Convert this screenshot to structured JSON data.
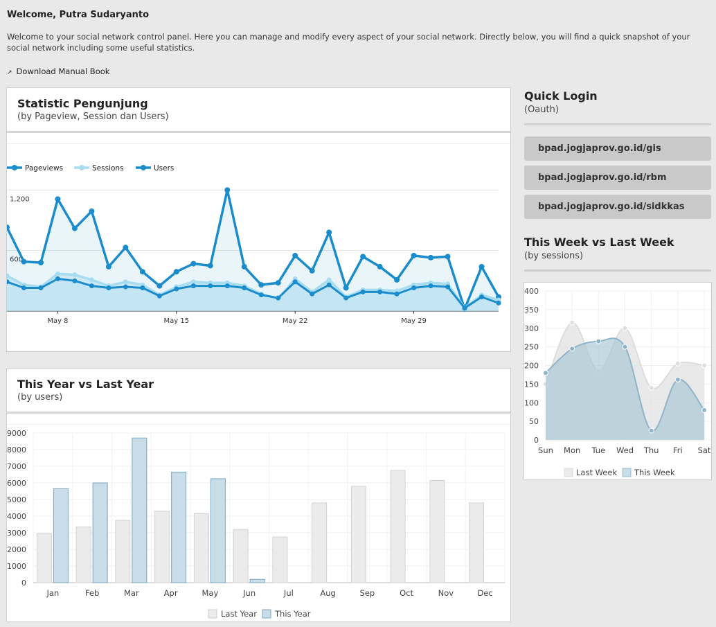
{
  "header": {
    "welcome": "Welcome, Putra Sudaryanto",
    "intro": "Welcome to your social network control panel. Here you can manage and modify every aspect of your social network. Directly below, you will find a quick snapshot of your social network including some useful statistics.",
    "download_label": "Download Manual Book"
  },
  "stat_panel": {
    "title": "Statistic Pengunjung",
    "subtitle": "(by Pageview, Session dan Users)"
  },
  "year_panel": {
    "title": "This Year vs Last Year",
    "subtitle": "(by users)"
  },
  "quick_login": {
    "title": "Quick Login",
    "subtitle": "(Oauth)",
    "links": [
      "bpad.jogjaprov.go.id/gis",
      "bpad.jogjaprov.go.id/rbm",
      "bpad.jogjaprov.go.id/sidkkas"
    ]
  },
  "week_panel": {
    "title": "This Week vs Last Week",
    "subtitle": "(by sessions)"
  },
  "colors": {
    "users": "#1a8ccc",
    "sessions": "#a8dcf0",
    "this_year_fill": "#c9dde9",
    "this_year_stroke": "#7aa6c0",
    "last_year_fill": "#ebebeb"
  },
  "chart_data": [
    {
      "type": "line",
      "x_labels": [
        "May 8",
        "May 15",
        "May 22",
        "May 29"
      ],
      "y_ticks": [
        "1,200",
        "600"
      ],
      "legend": [
        "Pageviews",
        "Sessions",
        "Users"
      ],
      "pageviews": [
        830,
        490,
        480,
        1110,
        820,
        990,
        440,
        630,
        390,
        250,
        390,
        470,
        450,
        1200,
        440,
        260,
        280,
        550,
        400,
        780,
        230,
        540,
        440,
        310,
        550,
        530,
        540,
        20,
        440,
        140
      ],
      "sessions": [
        350,
        260,
        240,
        370,
        360,
        310,
        250,
        290,
        260,
        160,
        240,
        290,
        280,
        280,
        250,
        170,
        120,
        320,
        190,
        310,
        140,
        210,
        210,
        200,
        260,
        280,
        270,
        30,
        160,
        110
      ],
      "users": [
        290,
        230,
        230,
        320,
        300,
        250,
        230,
        240,
        230,
        150,
        220,
        250,
        250,
        250,
        230,
        160,
        130,
        290,
        170,
        260,
        130,
        190,
        190,
        170,
        230,
        250,
        240,
        30,
        140,
        80
      ]
    },
    {
      "type": "bar",
      "categories": [
        "Jan",
        "Feb",
        "Mar",
        "Apr",
        "May",
        "Jun",
        "Jul",
        "Aug",
        "Sep",
        "Oct",
        "Nov",
        "Dec"
      ],
      "ylim": [
        0,
        9000
      ],
      "y_ticks": [
        0,
        1000,
        2000,
        3000,
        4000,
        5000,
        6000,
        7000,
        8000,
        9000
      ],
      "series": [
        {
          "name": "Last Year",
          "values": [
            2950,
            3350,
            3750,
            4300,
            4150,
            3200,
            2750,
            4800,
            5800,
            6750,
            6150,
            4800
          ]
        },
        {
          "name": "This Year",
          "values": [
            5650,
            6000,
            8700,
            6650,
            6250,
            200,
            null,
            null,
            null,
            null,
            null,
            null
          ]
        }
      ]
    },
    {
      "type": "area",
      "categories": [
        "Sun",
        "Mon",
        "Tue",
        "Wed",
        "Thu",
        "Fri",
        "Sat"
      ],
      "ylim": [
        0,
        400
      ],
      "y_ticks": [
        0,
        50,
        100,
        150,
        200,
        250,
        300,
        350,
        400
      ],
      "series": [
        {
          "name": "Last Week",
          "values": [
            150,
            315,
            185,
            300,
            140,
            205,
            200
          ]
        },
        {
          "name": "This Week",
          "values": [
            180,
            245,
            265,
            250,
            25,
            162,
            80
          ]
        }
      ]
    }
  ]
}
